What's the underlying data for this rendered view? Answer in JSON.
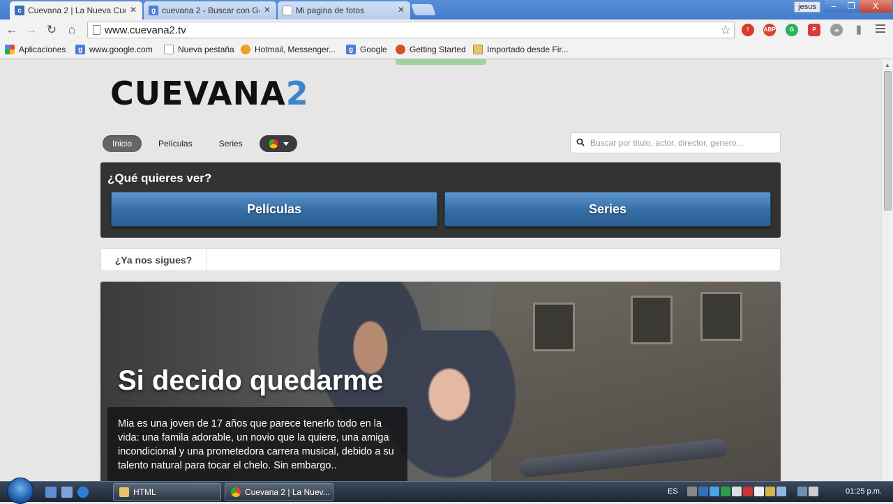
{
  "browser": {
    "tabs": [
      {
        "title": "Cuevana 2 | La Nueva Cue",
        "active": true
      },
      {
        "title": "cuevana 2 - Buscar con Go",
        "active": false
      },
      {
        "title": "Mi pagina de fotos",
        "active": false
      }
    ],
    "user": "jesus",
    "window_controls": {
      "minimize": "–",
      "maximize": "❐",
      "close": "X"
    },
    "url": "www.cuevana2.tv",
    "extensions": [
      {
        "icon": "adblock-alert-icon",
        "color": "#d83b2b"
      },
      {
        "icon": "abp-icon",
        "color": "#d5462f",
        "label": "ABP"
      },
      {
        "icon": "grammarly-icon",
        "color": "#2eb05a"
      },
      {
        "icon": "pocket-icon",
        "color": "#d93b3b"
      },
      {
        "icon": "cloud-icon",
        "color": "#9a9a9a"
      },
      {
        "icon": "equalizer-icon",
        "color": "#6b6b6b"
      }
    ],
    "bookmarks": [
      {
        "label": "Aplicaciones",
        "icon": "apps-grid-icon",
        "color": "#d44"
      },
      {
        "label": "www.google.com",
        "icon": "google-icon",
        "color": "#4a7fd9"
      },
      {
        "label": "Nueva pestaña",
        "icon": "page-icon",
        "color": "#ffffff"
      },
      {
        "label": "Hotmail, Messenger...",
        "icon": "msn-butterfly-icon",
        "color": "#e8a21b"
      },
      {
        "label": "Google",
        "icon": "google-icon",
        "color": "#4a7fd9"
      },
      {
        "label": "Getting Started",
        "icon": "firefox-icon",
        "color": "#d5502a"
      },
      {
        "label": "Importado desde Fir...",
        "icon": "folder-icon",
        "color": "#e7c46b"
      }
    ]
  },
  "site": {
    "logo_text": "CUEVANA",
    "logo_num": "2",
    "nav": [
      {
        "label": "Inicio",
        "active": true
      },
      {
        "label": "Películas",
        "active": false
      },
      {
        "label": "Series",
        "active": false
      }
    ],
    "search_placeholder": "Buscar por titulo, actor, director, genero...",
    "what_to_watch": {
      "title": "¿Qué quieres ver?",
      "buttons": [
        "Películas",
        "Series"
      ]
    },
    "follow_label": "¿Ya nos sigues?",
    "hero": {
      "title": "Si decido quedarme",
      "description": "Mia es una joven de 17 años que parece tenerlo todo en la vida: una famila adorable, un novio que la quiere, una amiga incondicional y una prometedora carrera musical, debido a su talento natural para tocar el chelo. Sin embargo.."
    },
    "accent_color": "#3c84cc"
  },
  "taskbar": {
    "tasks": [
      {
        "label": "HTML",
        "icon": "folder-icon"
      },
      {
        "label": "Cuevana 2 | La Nuev...",
        "icon": "chrome-icon"
      }
    ],
    "language": "ES",
    "time": "01:25 p.m."
  }
}
